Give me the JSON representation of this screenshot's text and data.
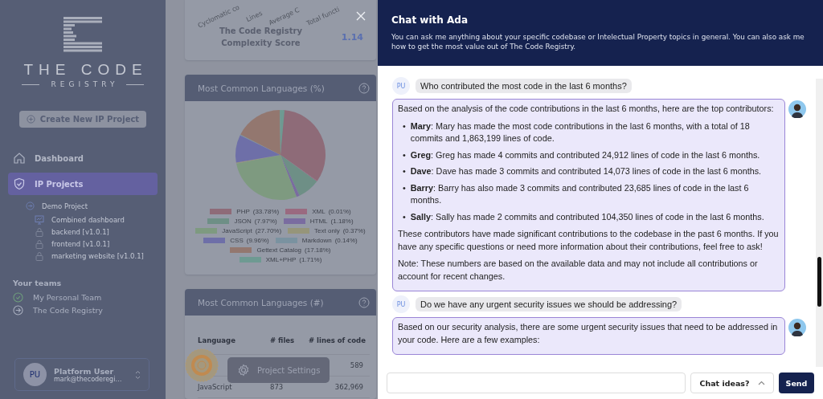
{
  "sidebar": {
    "logo_title": "THE CODE",
    "logo_subtitle": "REGISTRY",
    "create_button": "Create New IP Project",
    "nav": [
      {
        "label": "Dashboard",
        "selected": false
      },
      {
        "label": "IP Projects",
        "selected": true
      }
    ],
    "projects": [
      {
        "label": "Demo Project",
        "children": [
          {
            "label": "Combined dashboard",
            "kind": "dashboard"
          },
          {
            "label": "backend [v1.0.1]",
            "kind": "locked"
          },
          {
            "label": "frontend [v1.0.1]",
            "kind": "locked"
          },
          {
            "label": "marketing website [v1.0.1]",
            "kind": "locked"
          }
        ]
      }
    ],
    "teams_heading": "Your teams",
    "teams": [
      {
        "label": "My Personal Team",
        "selected": true
      },
      {
        "label": "The Code Registry",
        "selected": false
      }
    ],
    "user": {
      "initials": "PU",
      "name": "Platform User",
      "email": "mark@thecoderegi…"
    }
  },
  "dashboard": {
    "complexity": {
      "axis_labels": [
        "Cyclomatic co",
        "Lines",
        "Average C",
        "Total functi"
      ],
      "label": "The Code Registry Complexity Score",
      "value": "1.14"
    },
    "languages_pct": {
      "title": "Most Common Languages (%)",
      "legend": [
        {
          "percent": "(33.78%)",
          "color": "#8e6b78"
        },
        {
          "percent": "(0.01%)",
          "color": "#9a6a80"
        },
        {
          "percent": "(7.97%)",
          "color": "#6e8f86"
        },
        {
          "percent": "(1.18%)",
          "color": "#7a6ca0"
        },
        {
          "percent": "(27.70%)",
          "color": "#7e9a80"
        },
        {
          "percent": "(0.37%)",
          "color": "#96957a"
        },
        {
          "percent": "(9.96%)",
          "color": "#6e6fa8"
        },
        {
          "percent": "(0.14%)",
          "color": "#7a92a0"
        },
        {
          "percent": "(17.18%)",
          "color": "#93776f"
        },
        {
          "percent": "(1.71%)",
          "color": "#6e9a92"
        }
      ],
      "chart_data": {
        "type": "pie",
        "categories": [
          "PHP",
          "XML",
          "JSON",
          "HTML",
          "JavaScript",
          "Text only",
          "CSS",
          "Markdown",
          "Gettext Catalog",
          "XML+PHP"
        ],
        "values": [
          33.78,
          0.01,
          7.97,
          1.18,
          27.7,
          0.37,
          9.96,
          0.14,
          17.18,
          1.71
        ]
      }
    },
    "languages_count": {
      "title": "Most Common Languages (#)",
      "columns": [
        "Language",
        "# files",
        "# lines of code"
      ],
      "rows": [
        {
          "lines_of_code": "589"
        },
        {
          "language": "JavaScript",
          "files": "873",
          "lines_of_code": "362,969"
        }
      ]
    },
    "project_settings_button": "Project Settings"
  },
  "chat": {
    "title": "Chat with Ada",
    "description": "You can ask me anything about your specific codebase or Intelectual Property topics in general. You can also ask me how to get the most value out of The Code Registry.",
    "messages": [
      {
        "kind": "user",
        "initials": "PU",
        "text": "Who contributed the most code in the last 6 months?"
      },
      {
        "kind": "assistant",
        "blocks": [
          {
            "kind": "p",
            "text": "Based on the analysis of the code contributions in the last 6 months, here are the top contributors:"
          },
          {
            "kind": "list",
            "marker": "•",
            "items": [
              "**Mary**: Mary has made the most code contributions in the last 6 months, with a total of 18 commits and 1,863,199 lines of code.",
              "**Greg**: Greg has made 4 commits and contributed 24,912 lines of code in the last 6 months.",
              "**Dave**: Dave has made 3 commits and contributed 14,073 lines of code in the last 6 months.",
              "**Barry**: Barry has also made 3 commits and contributed 23,685 lines of code in the last 6 months.",
              "**Sally**: Sally has made 2 commits and contributed 104,350 lines of code in the last 6 months."
            ]
          },
          {
            "kind": "p",
            "text": "These contributors have made significant contributions to the codebase in the past 6 months. If you have any specific questions or need more information about their contributions, feel free to ask!"
          },
          {
            "kind": "p",
            "text": "Note: These numbers are based on the available data and may not include all contributions or account for recent changes."
          }
        ]
      },
      {
        "kind": "user",
        "initials": "PU",
        "text": "Do we have any urgent security issues we should be addressing?"
      },
      {
        "kind": "assistant",
        "blocks": [
          {
            "kind": "p",
            "text": "Based on our security analysis, there are some urgent security issues that need to be addressed in your code. Here are a few examples:"
          }
        ]
      }
    ],
    "ideas_button": "Chat ideas?",
    "send_button": "Send"
  }
}
